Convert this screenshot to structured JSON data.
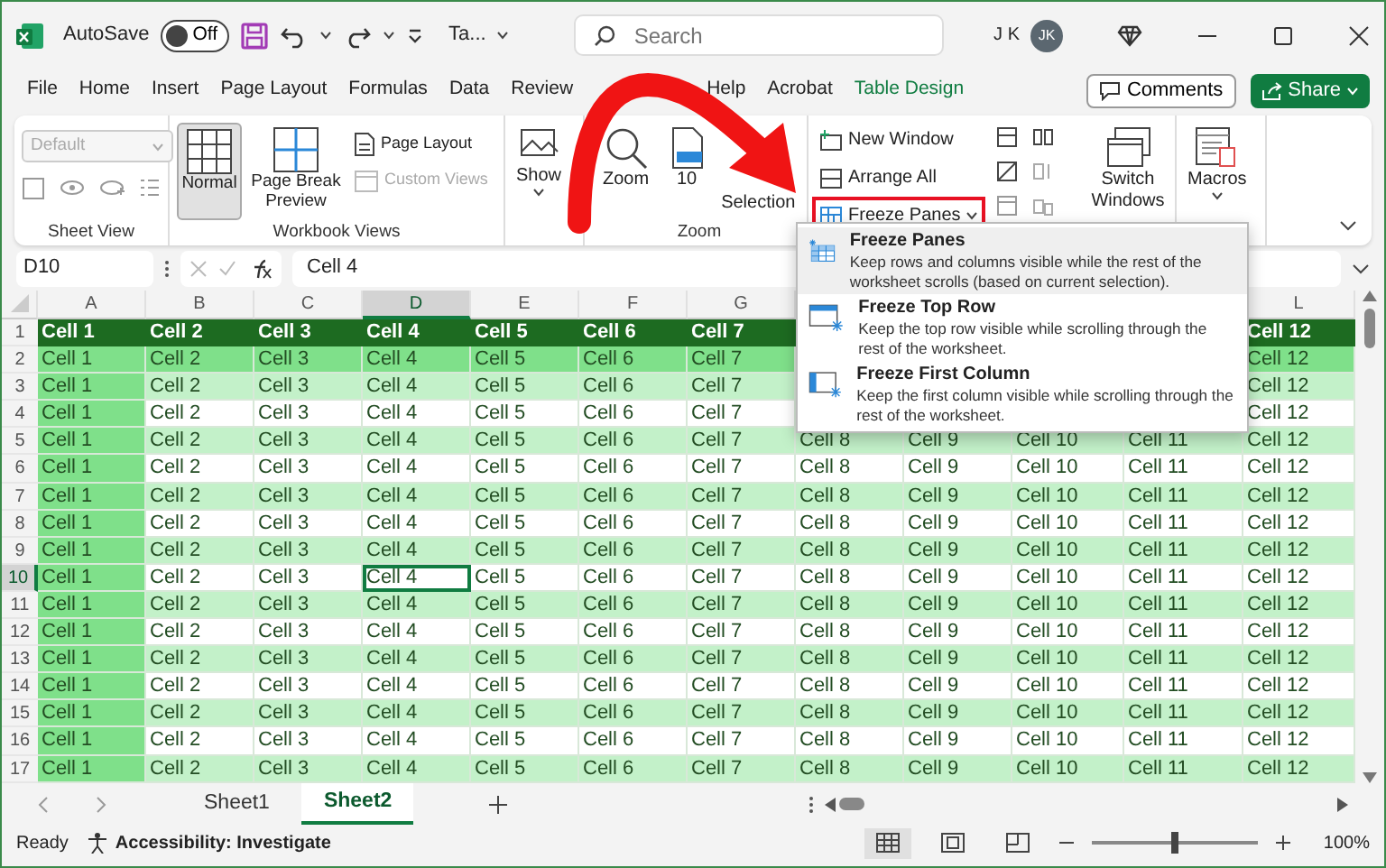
{
  "titlebar": {
    "autosave_label": "AutoSave",
    "autosave": {
      "label": "Off",
      "on": false
    },
    "filename": "Ta...",
    "search": {
      "placeholder": "Search"
    },
    "user_name": "J K",
    "avatar": "JK"
  },
  "tabs": [
    {
      "label": "File",
      "selected": false,
      "kind": "standard"
    },
    {
      "label": "Home",
      "selected": false,
      "kind": "standard"
    },
    {
      "label": "Insert",
      "selected": false,
      "kind": "standard"
    },
    {
      "label": "Page Layout",
      "selected": false,
      "kind": "standard"
    },
    {
      "label": "Formulas",
      "selected": false,
      "kind": "standard"
    },
    {
      "label": "Data",
      "selected": false,
      "kind": "standard"
    },
    {
      "label": "Review",
      "selected": false,
      "kind": "standard"
    },
    {
      "label": "Help",
      "selected": false,
      "kind": "standard"
    },
    {
      "label": "Acrobat",
      "selected": false,
      "kind": "standard"
    },
    {
      "label": "Table Design",
      "selected": false,
      "kind": "contextual"
    }
  ],
  "actions": {
    "comments": "Comments",
    "share": "Share"
  },
  "ribbon": {
    "groups": [
      {
        "kind": "sheet_view",
        "label": "Sheet View",
        "dropdown": {
          "value": "Default",
          "disabled": true
        }
      },
      {
        "kind": "workbook_views",
        "label": "Workbook Views",
        "large": [
          {
            "label": "Normal",
            "selected": true
          },
          {
            "label": "Page Break Preview",
            "selected": false
          }
        ],
        "small": [
          {
            "label": "Page Layout",
            "disabled": false
          },
          {
            "label": "Custom Views",
            "disabled": true
          }
        ]
      },
      {
        "kind": "show",
        "button": "Show"
      },
      {
        "kind": "zoom",
        "label": "Zoom",
        "buttons": [
          "Zoom",
          "10",
          "Selection"
        ]
      },
      {
        "kind": "window",
        "items": [
          {
            "label": "New Window",
            "annotated": false
          },
          {
            "label": "Arrange All",
            "annotated": false
          },
          {
            "label": "Freeze Panes",
            "annotated": true
          }
        ],
        "switch": "Switch Windows"
      },
      {
        "kind": "macros",
        "button": "Macros"
      }
    ]
  },
  "formula_bar": {
    "name_box": "D10",
    "value": "Cell 4"
  },
  "columns": [
    {
      "label": "A",
      "emphasis": true,
      "selected": false
    },
    {
      "label": "B",
      "emphasis": false,
      "selected": false
    },
    {
      "label": "C",
      "emphasis": false,
      "selected": false
    },
    {
      "label": "D",
      "emphasis": false,
      "selected": true
    },
    {
      "label": "E",
      "emphasis": false,
      "selected": false
    },
    {
      "label": "F",
      "emphasis": false,
      "selected": false
    },
    {
      "label": "G",
      "emphasis": false,
      "selected": false
    },
    {
      "emphasis": false,
      "selected": false
    },
    {
      "emphasis": false,
      "selected": false
    },
    {
      "emphasis": false,
      "selected": false
    },
    {
      "emphasis": false,
      "selected": false
    },
    {
      "label": "L",
      "emphasis": false,
      "selected": false
    }
  ],
  "rows": [
    {
      "number": "1",
      "kind": "header",
      "selected": false,
      "cells": [
        "Cell 1",
        "Cell 2",
        "Cell 3",
        "Cell 4",
        "Cell 5",
        "Cell 6",
        "Cell 7",
        null,
        null,
        null,
        null,
        "Cell 12"
      ]
    },
    {
      "number": "2",
      "kind": "accent",
      "selected": false,
      "cells": [
        "Cell 1",
        "Cell 2",
        "Cell 3",
        "Cell 4",
        "Cell 5",
        "Cell 6",
        "Cell 7",
        null,
        null,
        null,
        null,
        "Cell 12"
      ]
    },
    {
      "number": "3",
      "kind": "band",
      "selected": false,
      "cells": [
        "Cell 1",
        "Cell 2",
        "Cell 3",
        "Cell 4",
        "Cell 5",
        "Cell 6",
        "Cell 7",
        null,
        null,
        null,
        null,
        "Cell 12"
      ]
    },
    {
      "number": "4",
      "kind": "plain",
      "selected": false,
      "cells": [
        "Cell 1",
        "Cell 2",
        "Cell 3",
        "Cell 4",
        "Cell 5",
        "Cell 6",
        "Cell 7",
        null,
        null,
        null,
        null,
        "Cell 12"
      ]
    },
    {
      "number": "5",
      "kind": "band",
      "selected": false,
      "cells": [
        "Cell 1",
        "Cell 2",
        "Cell 3",
        "Cell 4",
        "Cell 5",
        "Cell 6",
        "Cell 7",
        "Cell 8",
        "Cell 9",
        "Cell 10",
        "Cell 11",
        "Cell 12"
      ]
    },
    {
      "number": "6",
      "kind": "plain",
      "selected": false,
      "cells": [
        "Cell 1",
        "Cell 2",
        "Cell 3",
        "Cell 4",
        "Cell 5",
        "Cell 6",
        "Cell 7",
        "Cell 8",
        "Cell 9",
        "Cell 10",
        "Cell 11",
        "Cell 12"
      ]
    },
    {
      "number": "7",
      "kind": "band",
      "selected": false,
      "cells": [
        "Cell 1",
        "Cell 2",
        "Cell 3",
        "Cell 4",
        "Cell 5",
        "Cell 6",
        "Cell 7",
        "Cell 8",
        "Cell 9",
        "Cell 10",
        "Cell 11",
        "Cell 12"
      ]
    },
    {
      "number": "8",
      "kind": "plain",
      "selected": false,
      "cells": [
        "Cell 1",
        "Cell 2",
        "Cell 3",
        "Cell 4",
        "Cell 5",
        "Cell 6",
        "Cell 7",
        "Cell 8",
        "Cell 9",
        "Cell 10",
        "Cell 11",
        "Cell 12"
      ]
    },
    {
      "number": "9",
      "kind": "band",
      "selected": false,
      "cells": [
        "Cell 1",
        "Cell 2",
        "Cell 3",
        "Cell 4",
        "Cell 5",
        "Cell 6",
        "Cell 7",
        "Cell 8",
        "Cell 9",
        "Cell 10",
        "Cell 11",
        "Cell 12"
      ]
    },
    {
      "number": "10",
      "kind": "plain",
      "selected": true,
      "cells": [
        "Cell 1",
        "Cell 2",
        "Cell 3",
        "Cell 4",
        "Cell 5",
        "Cell 6",
        "Cell 7",
        "Cell 8",
        "Cell 9",
        "Cell 10",
        "Cell 11",
        "Cell 12"
      ]
    },
    {
      "number": "11",
      "kind": "band",
      "selected": false,
      "cells": [
        "Cell 1",
        "Cell 2",
        "Cell 3",
        "Cell 4",
        "Cell 5",
        "Cell 6",
        "Cell 7",
        "Cell 8",
        "Cell 9",
        "Cell 10",
        "Cell 11",
        "Cell 12"
      ]
    },
    {
      "number": "12",
      "kind": "plain",
      "selected": false,
      "cells": [
        "Cell 1",
        "Cell 2",
        "Cell 3",
        "Cell 4",
        "Cell 5",
        "Cell 6",
        "Cell 7",
        "Cell 8",
        "Cell 9",
        "Cell 10",
        "Cell 11",
        "Cell 12"
      ]
    },
    {
      "number": "13",
      "kind": "band",
      "selected": false,
      "cells": [
        "Cell 1",
        "Cell 2",
        "Cell 3",
        "Cell 4",
        "Cell 5",
        "Cell 6",
        "Cell 7",
        "Cell 8",
        "Cell 9",
        "Cell 10",
        "Cell 11",
        "Cell 12"
      ]
    },
    {
      "number": "14",
      "kind": "plain",
      "selected": false,
      "cells": [
        "Cell 1",
        "Cell 2",
        "Cell 3",
        "Cell 4",
        "Cell 5",
        "Cell 6",
        "Cell 7",
        "Cell 8",
        "Cell 9",
        "Cell 10",
        "Cell 11",
        "Cell 12"
      ]
    },
    {
      "number": "15",
      "kind": "band",
      "selected": false,
      "cells": [
        "Cell 1",
        "Cell 2",
        "Cell 3",
        "Cell 4",
        "Cell 5",
        "Cell 6",
        "Cell 7",
        "Cell 8",
        "Cell 9",
        "Cell 10",
        "Cell 11",
        "Cell 12"
      ]
    },
    {
      "number": "16",
      "kind": "plain",
      "selected": false,
      "cells": [
        "Cell 1",
        "Cell 2",
        "Cell 3",
        "Cell 4",
        "Cell 5",
        "Cell 6",
        "Cell 7",
        "Cell 8",
        "Cell 9",
        "Cell 10",
        "Cell 11",
        "Cell 12"
      ]
    },
    {
      "number": "17",
      "kind": "band",
      "selected": false,
      "cells": [
        "Cell 1",
        "Cell 2",
        "Cell 3",
        "Cell 4",
        "Cell 5",
        "Cell 6",
        "Cell 7",
        "Cell 8",
        "Cell 9",
        "Cell 10",
        "Cell 11",
        "Cell 12"
      ]
    }
  ],
  "sheets": [
    {
      "label": "Sheet1",
      "selected": false
    },
    {
      "label": "Sheet2",
      "selected": true
    }
  ],
  "menu": {
    "items": [
      {
        "kind": "panes",
        "title": "Freeze Panes",
        "description": "Keep rows and columns visible while the rest of the worksheet scrolls (based on current selection).",
        "selected": true
      },
      {
        "kind": "top_row",
        "title": "Freeze Top Row",
        "description": "Keep the top row visible while scrolling through the rest of the worksheet.",
        "selected": false
      },
      {
        "kind": "first_column",
        "title": "Freeze First Column",
        "description": "Keep the first column visible while scrolling through the rest of the worksheet.",
        "selected": false
      }
    ]
  },
  "status_bar": {
    "ready": "Ready",
    "accessibility": "Accessibility: Investigate",
    "views": [
      {
        "kind": "normal",
        "selected": true
      },
      {
        "kind": "page_layout",
        "selected": false
      },
      {
        "kind": "page_break",
        "selected": false
      }
    ],
    "zoom": {
      "level": 0.5
    },
    "zoom_label": "100%"
  }
}
